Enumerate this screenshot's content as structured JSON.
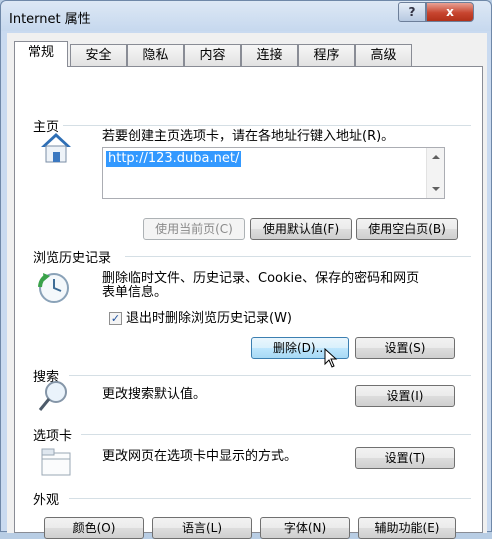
{
  "window": {
    "title": "Internet 属性",
    "help_label": "?",
    "close_label": "x"
  },
  "tabs": [
    {
      "label": "常规",
      "active": true
    },
    {
      "label": "安全"
    },
    {
      "label": "隐私"
    },
    {
      "label": "内容"
    },
    {
      "label": "连接"
    },
    {
      "label": "程序"
    },
    {
      "label": "高级"
    }
  ],
  "home": {
    "group_title": "主页",
    "description": "若要创建主页选项卡，请在各地址行键入地址(R)。",
    "url": "http://123.duba.net/",
    "use_current": "使用当前页(C)",
    "use_default": "使用默认值(F)",
    "use_blank": "使用空白页(B)"
  },
  "history": {
    "group_title": "浏览历史记录",
    "description_line1": "删除临时文件、历史记录、Cookie、保存的密码和网页",
    "description_line2": "表单信息。",
    "checkbox_label": "退出时删除浏览历史记录(W)",
    "checkbox_checked": true,
    "delete_button": "删除(D)...",
    "settings_button": "设置(S)"
  },
  "search": {
    "group_title": "搜索",
    "description": "更改搜索默认值。",
    "settings_button": "设置(I)"
  },
  "tabs_section": {
    "group_title": "选项卡",
    "description": "更改网页在选项卡中显示的方式。",
    "settings_button": "设置(T)"
  },
  "appearance": {
    "group_title": "外观",
    "colors_button": "颜色(O)",
    "languages_button": "语言(L)",
    "fonts_button": "字体(N)",
    "accessibility_button": "辅助功能(E)"
  },
  "icons": {
    "home": "home-icon",
    "history": "history-clock-icon",
    "search": "magnifier-icon",
    "tabs": "tabs-window-icon",
    "cursor": "mouse-pointer-icon"
  },
  "colors": {
    "accent": "#3399ff",
    "close": "#c7452f"
  }
}
